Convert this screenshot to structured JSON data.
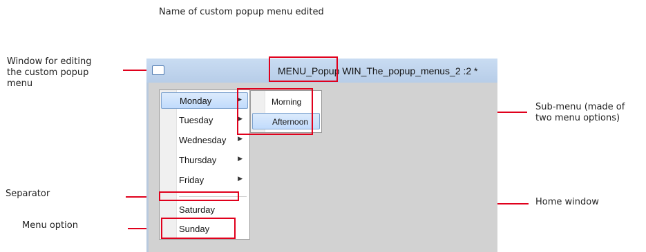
{
  "caption_top": "Name of custom popup menu edited",
  "annotations": {
    "window_line1": "Window for editing",
    "window_line2": "the custom popup",
    "window_line3": "menu",
    "submenu_line1": "Sub-menu (made of",
    "submenu_line2": "two menu options)",
    "separator": "Separator",
    "home_window": "Home window",
    "menu_option": "Menu option"
  },
  "window": {
    "title": "MENU_Popup WIN_The_popup_menus_2 :2 *"
  },
  "menu": {
    "items": [
      {
        "label": "Monday",
        "arrow": "▶"
      },
      {
        "label": "Tuesday",
        "arrow": "▶"
      },
      {
        "label": "Wednesday",
        "arrow": "▶"
      },
      {
        "label": "Thursday",
        "arrow": "▶"
      },
      {
        "label": "Friday",
        "arrow": "▶"
      },
      {
        "label": "Saturday"
      },
      {
        "label": "Sunday"
      }
    ]
  },
  "submenu": {
    "items": [
      {
        "label": "Morning"
      },
      {
        "label": "Afternoon"
      }
    ]
  },
  "colors": {
    "annotation_red": "#e0001c",
    "highlight_blue": "#c1dbfc",
    "home_gray": "#d2d2d2"
  }
}
